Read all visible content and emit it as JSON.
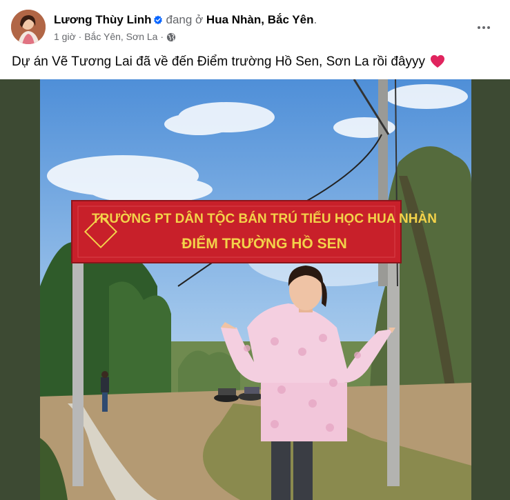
{
  "post": {
    "author_name": "Lương Thùy Linh",
    "status_prefix": "đang ở",
    "place": "Hua Nhàn, Bắc Yên",
    "status_suffix": ".",
    "time": "1 giờ",
    "separator": "·",
    "location": "Bắc Yên, Sơn La",
    "text": "Dự án Vẽ Tương Lai đã về đến Điểm trường Hồ Sen, Sơn La rồi đâyyy",
    "icons": {
      "verified": "verified-badge-icon",
      "audience": "globe-icon",
      "more": "more-options-icon",
      "emoji": "red-heart-icon"
    }
  },
  "photo": {
    "sign_line1": "TRƯỜNG PT DÂN TỘC BÁN TRÚ TIỂU HỌC HUA NHÀN",
    "sign_line2": "ĐIỂM TRƯỜNG HỒ SEN"
  },
  "colors": {
    "verified": "#0866ff",
    "text_primary": "#050505",
    "text_secondary": "#65676b",
    "media_background": "#3d4a33",
    "sign_background": "#c8202a",
    "sign_text": "#f3d24a",
    "heart": "#e0245e"
  }
}
